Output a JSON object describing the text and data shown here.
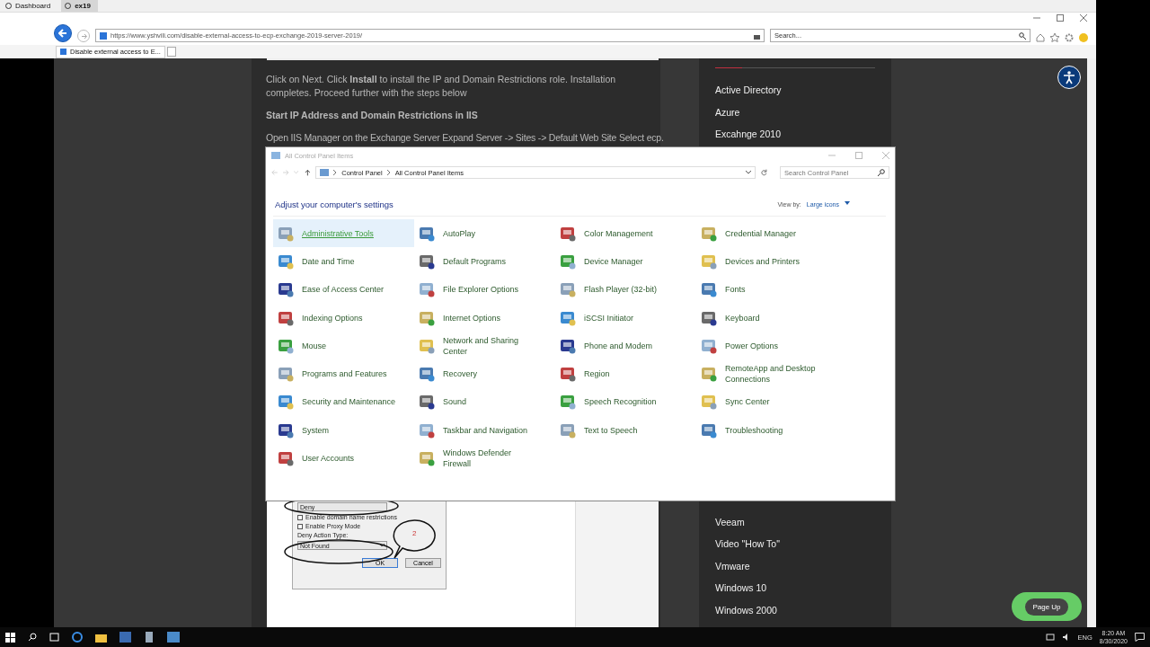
{
  "browser": {
    "top_tabs": [
      {
        "label": "Dashboard",
        "selected": false
      },
      {
        "label": "ex19",
        "selected": true
      }
    ],
    "url": "https://www.yshvili.com/disable-external-access-to-ecp-exchange-2019-server-2019/",
    "search": {
      "placeholder": "Search..."
    },
    "tabs": [
      {
        "label": "Disable external access to E...",
        "selected": true
      }
    ]
  },
  "article": {
    "paragraphs": [
      {
        "kind": "text",
        "text": "Click on Next. Click **Install** to install the IP and Domain Restrictions role. Installation completes. Proceed further with the steps below"
      },
      {
        "kind": "heading",
        "text": "Start IP Address and Domain Restrictions in IIS"
      },
      {
        "kind": "text",
        "text": "Open IIS Manager on the Exchange Server Expand Server -> Sites -> Default Web Site Select ecp."
      }
    ],
    "dialog_image": {
      "deny_value": "Deny",
      "checkboxes": [
        {
          "label": "Enable domain name restrictions",
          "checked": false
        },
        {
          "label": "Enable Proxy Mode",
          "checked": false
        }
      ],
      "action_label": "Deny Action Type:",
      "action_value": "Not Found",
      "callout": "2",
      "buttons": [
        "OK",
        "Cancel"
      ]
    }
  },
  "sidebar": {
    "top_items": [
      "Active Directory",
      "Azure",
      "Excahnge 2010"
    ],
    "bottom_items": [
      "Veeam",
      "Video \"How To\"",
      "Vmware",
      "Windows 10",
      "Windows 2000"
    ]
  },
  "page_up": "Page Up",
  "control_panel": {
    "title": "All Control Panel Items",
    "breadcrumb": [
      "Control Panel",
      "All Control Panel Items"
    ],
    "search": {
      "placeholder": "Search Control Panel"
    },
    "heading": "Adjust your computer's settings",
    "view_by_label": "View by:",
    "view_by_value": "Large icons",
    "items": [
      {
        "label": "Administrative Tools",
        "selected": true
      },
      {
        "label": "AutoPlay",
        "selected": false
      },
      {
        "label": "Color Management",
        "selected": false
      },
      {
        "label": "Credential Manager",
        "selected": false
      },
      {
        "label": "Date and Time",
        "selected": false
      },
      {
        "label": "Default Programs",
        "selected": false
      },
      {
        "label": "Device Manager",
        "selected": false
      },
      {
        "label": "Devices and Printers",
        "selected": false
      },
      {
        "label": "Ease of Access Center",
        "selected": false
      },
      {
        "label": "File Explorer Options",
        "selected": false
      },
      {
        "label": "Flash Player (32-bit)",
        "selected": false
      },
      {
        "label": "Fonts",
        "selected": false
      },
      {
        "label": "Indexing Options",
        "selected": false
      },
      {
        "label": "Internet Options",
        "selected": false
      },
      {
        "label": "iSCSI Initiator",
        "selected": false
      },
      {
        "label": "Keyboard",
        "selected": false
      },
      {
        "label": "Mouse",
        "selected": false
      },
      {
        "label": "Network and Sharing Center",
        "selected": false
      },
      {
        "label": "Phone and Modem",
        "selected": false
      },
      {
        "label": "Power Options",
        "selected": false
      },
      {
        "label": "Programs and Features",
        "selected": false
      },
      {
        "label": "Recovery",
        "selected": false
      },
      {
        "label": "Region",
        "selected": false
      },
      {
        "label": "RemoteApp and Desktop Connections",
        "selected": false
      },
      {
        "label": "Security and Maintenance",
        "selected": false
      },
      {
        "label": "Sound",
        "selected": false
      },
      {
        "label": "Speech Recognition",
        "selected": false
      },
      {
        "label": "Sync Center",
        "selected": false
      },
      {
        "label": "System",
        "selected": false
      },
      {
        "label": "Taskbar and Navigation",
        "selected": false
      },
      {
        "label": "Text to Speech",
        "selected": false
      },
      {
        "label": "Troubleshooting",
        "selected": false
      },
      {
        "label": "User Accounts",
        "selected": false
      },
      {
        "label": "Windows Defender Firewall",
        "selected": false
      }
    ]
  },
  "taskbar": {
    "language": "ENG",
    "time": "8:20 AM",
    "date": "8/30/2020"
  }
}
